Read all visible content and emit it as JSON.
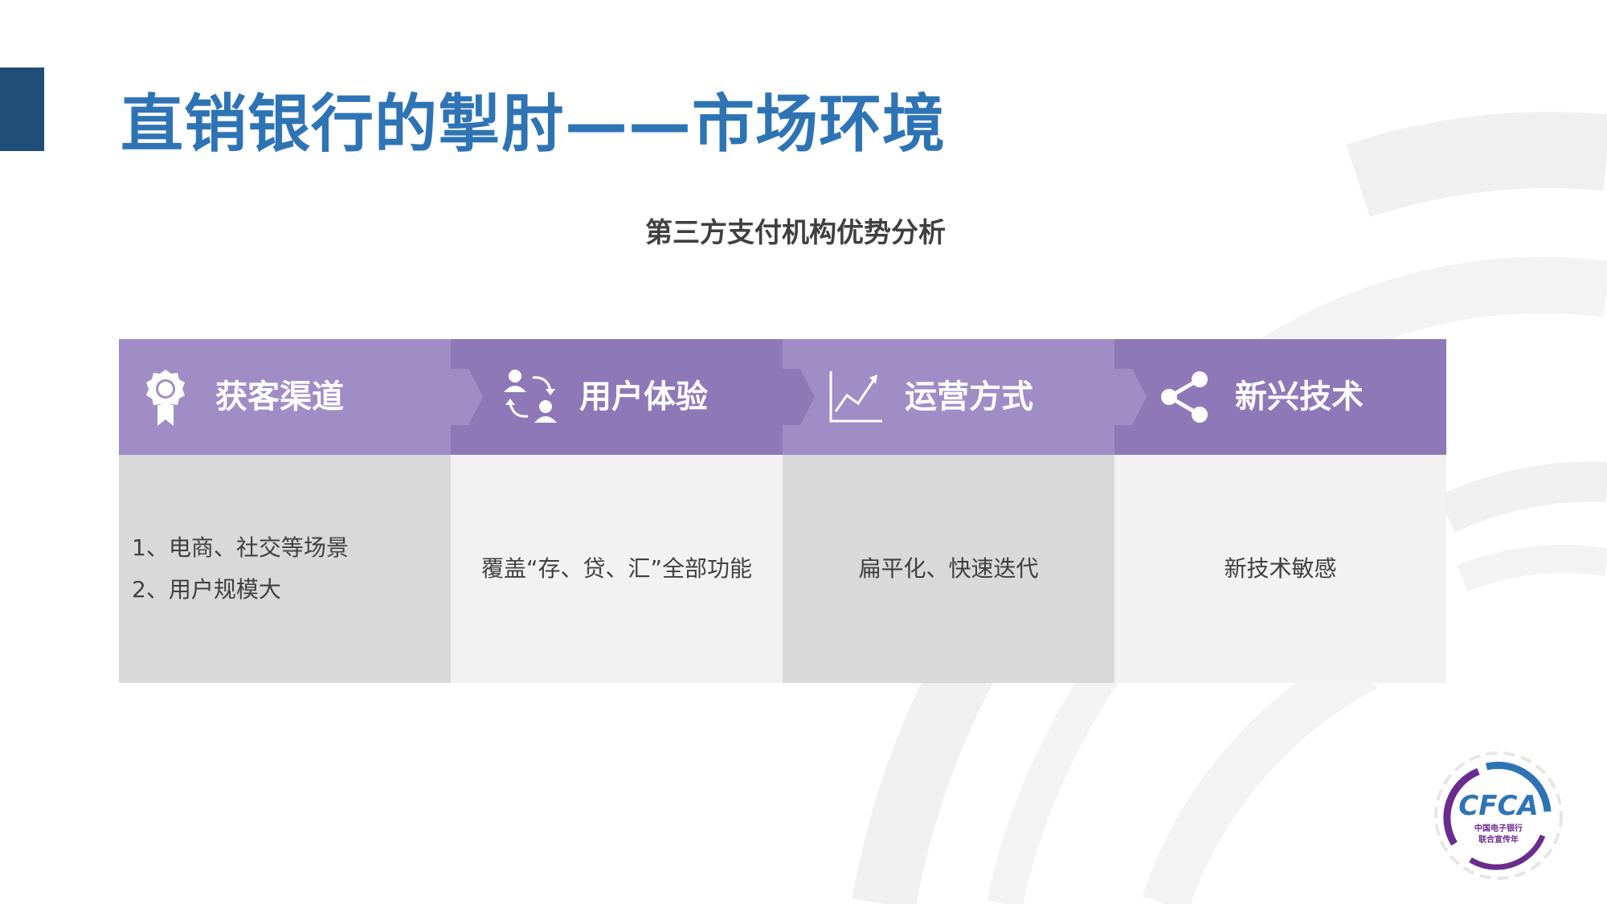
{
  "slide": {
    "title": "直销银行的掣肘——市场环境",
    "subtitle": "第三方支付机构优势分析"
  },
  "columns": [
    {
      "header": "获客渠道",
      "icon": "award-ribbon-icon",
      "lines": [
        "1、电商、社交等场景",
        "2、用户规模大"
      ]
    },
    {
      "header": "用户体验",
      "icon": "user-exchange-icon",
      "lines": [
        "覆盖“存、贷、汇”全部功能"
      ]
    },
    {
      "header": "运营方式",
      "icon": "line-chart-icon",
      "lines": [
        "扁平化、快速迭代"
      ]
    },
    {
      "header": "新兴技术",
      "icon": "share-icon",
      "lines": [
        "新技术敏感"
      ]
    }
  ],
  "logo": {
    "brand": "CFCA",
    "caption_line1": "中国电子银行",
    "caption_line2": "联合宣传年"
  },
  "colors": {
    "title": "#2e74b5",
    "accent_bar": "#1f4e79",
    "header_light": "#a08dc6",
    "header_dark": "#8f78b8",
    "body_gray": "#d9d9d9",
    "body_light": "#f2f2f2"
  }
}
